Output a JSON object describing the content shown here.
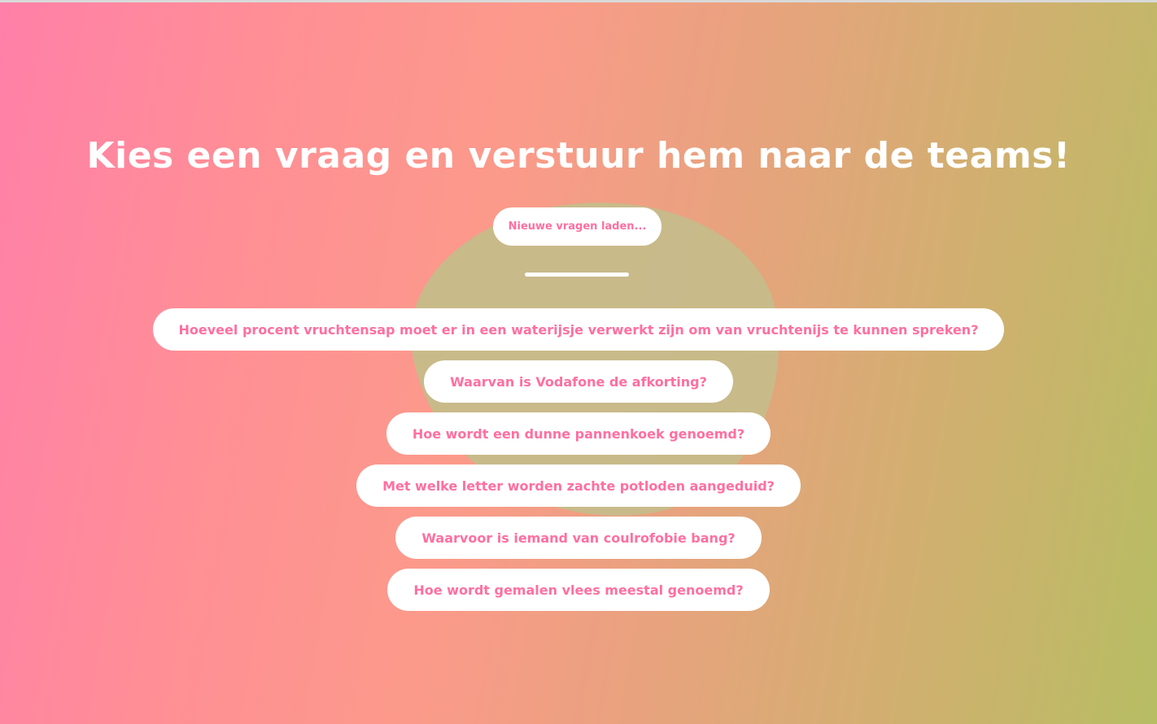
{
  "page": {
    "title": "Kies een vraag en verstuur hem naar de teams!",
    "load_button_label": "Nieuwe vragen laden..."
  },
  "questions": [
    {
      "label": "Hoeveel procent vruchtensap moet er in een waterijsje verwerkt zijn om van vruchtenijs te kunnen spreken?"
    },
    {
      "label": "Waarvan is Vodafone de afkorting?"
    },
    {
      "label": "Hoe wordt een dunne pannenkoek genoemd?"
    },
    {
      "label": "Met welke letter worden zachte potloden aangeduid?"
    },
    {
      "label": "Waarvoor is iemand van coulrofobie bang?"
    },
    {
      "label": "Hoe wordt gemalen vlees meestal genoemd?"
    }
  ],
  "colors": {
    "accent_text": "#ff6f9f",
    "button_bg": "#ffffff",
    "gradient_start": "#ff80a8",
    "gradient_end": "#b7bd63",
    "blob": "#c6bc8a"
  }
}
